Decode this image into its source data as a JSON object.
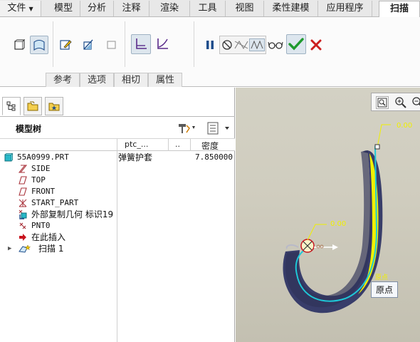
{
  "ribbon": {
    "file_tab": "文件",
    "tabs": [
      "模型",
      "分析",
      "注释",
      "渲染",
      "工具",
      "视图",
      "柔性建模",
      "应用程序"
    ],
    "active_tab": "扫描",
    "subtabs": [
      "参考",
      "选项",
      "相切",
      "属性"
    ]
  },
  "model_tree": {
    "title": "模型树",
    "columns": {
      "param": "ptc_...",
      "dots": "..",
      "density": "密度"
    },
    "part": {
      "name": "55A0999.PRT",
      "param": "弹簧护套",
      "density": "7.850000"
    },
    "items": [
      {
        "label": "SIDE",
        "icon": "datum-plane-icon"
      },
      {
        "label": "TOP",
        "icon": "datum-plane-icon"
      },
      {
        "label": "FRONT",
        "icon": "datum-plane-icon"
      },
      {
        "label": "START_PART",
        "icon": "coordinate-system-icon"
      },
      {
        "label": "外部复制几何 标识19",
        "icon": "copy-geometry-icon"
      },
      {
        "label": "PNT0",
        "icon": "datum-point-icon"
      },
      {
        "label": "在此插入",
        "icon": "insert-here-arrow-icon"
      },
      {
        "label": "扫描 1",
        "icon": "sweep-feature-icon"
      }
    ]
  },
  "viewport": {
    "dim_top": "0.00",
    "dim_mid": "0.00",
    "origin_small": "原点",
    "tooltip": "原点"
  },
  "colors": {
    "accent_blue": "#1f4e8c",
    "confirm_green": "#1f9a2d",
    "cancel_red": "#cc1f1f",
    "trajectory_cyan": "#1ec8d8",
    "surface_yellow": "#f0f000",
    "surface_navy": "#383d6a"
  }
}
